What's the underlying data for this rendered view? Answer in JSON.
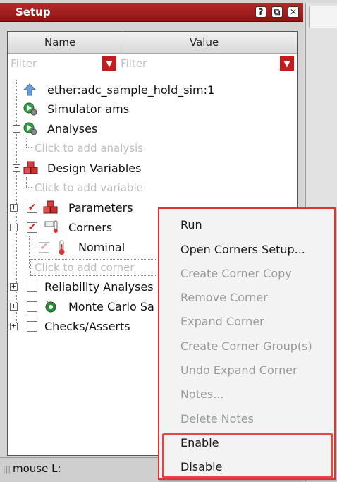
{
  "window": {
    "title": "Setup"
  },
  "titlebar_buttons": {
    "help": "?",
    "float": "⧉",
    "close": "✕"
  },
  "table": {
    "col_name": "Name",
    "col_value": "Value",
    "filter_name_placeholder": "Filter",
    "filter_value_placeholder": "Filter"
  },
  "tree": {
    "test": "ether:adc_sample_hold_sim:1",
    "simulator": "Simulator  ams",
    "analyses": "Analyses",
    "add_analysis": "Click to add analysis",
    "design_variables": "Design Variables",
    "add_variable": "Click to add variable",
    "parameters": "Parameters",
    "corners": "Corners",
    "nominal": "Nominal",
    "add_corner": "Click to add corner",
    "reliability": "Reliability Analyses",
    "monte_carlo": "Monte Carlo Sa",
    "checks": "Checks/Asserts"
  },
  "status_bar": {
    "text": "mouse L:"
  },
  "context_menu": {
    "items": [
      {
        "label": "Run",
        "enabled": true
      },
      {
        "label": "Open Corners Setup...",
        "enabled": true
      },
      {
        "label": "Create Corner Copy",
        "enabled": false
      },
      {
        "label": "Remove Corner",
        "enabled": false
      },
      {
        "label": "Expand Corner",
        "enabled": false
      },
      {
        "label": "Create Corner Group(s)",
        "enabled": false
      },
      {
        "label": "Undo Expand Corner",
        "enabled": false
      },
      {
        "label": "Notes...",
        "enabled": false
      },
      {
        "label": "Delete Notes",
        "enabled": false
      },
      {
        "label": "Enable",
        "enabled": true
      },
      {
        "label": "Disable",
        "enabled": true
      }
    ]
  },
  "colors": {
    "titlebar": "#a31f1f",
    "accent": "#d33333",
    "disabled_text": "#9a9a9a"
  },
  "icons": [
    "test-arrow-icon",
    "simulator-gear-icon",
    "analyses-gear-icon",
    "design-variables-cubes-icon",
    "parameters-cubes-icon",
    "corners-thermometer-icon",
    "nominal-thermometer-icon",
    "monte-carlo-dice-icon"
  ]
}
